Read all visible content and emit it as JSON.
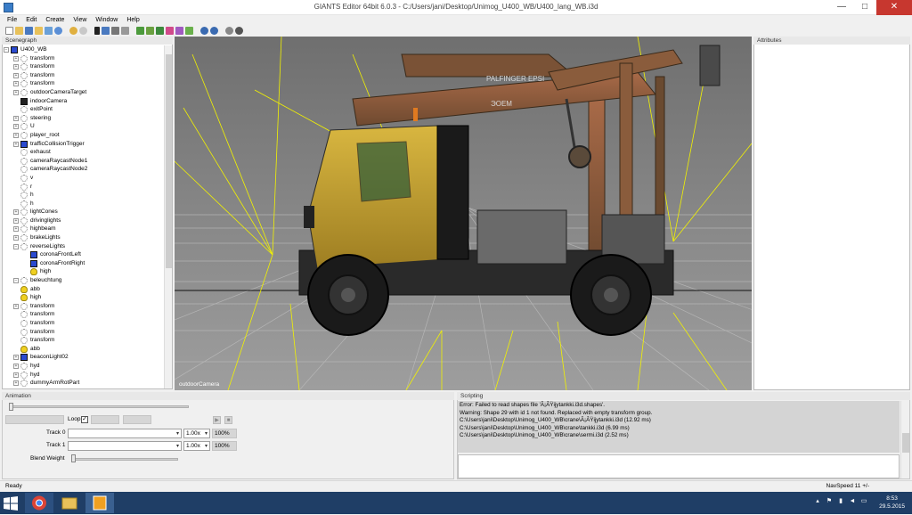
{
  "window": {
    "title": "GIANTS Editor 64bit 6.0.3 - C:/Users/jani/Desktop/Unimog_U400_WB/U400_lang_WB.i3d",
    "minimize": "—",
    "maximize": "□",
    "close": "✕"
  },
  "menu": [
    "File",
    "Edit",
    "Create",
    "View",
    "Window",
    "Help"
  ],
  "scenegraph": {
    "title": "Scenegraph",
    "items": [
      {
        "label": "U400_WB",
        "depth": 0,
        "icon": "cube-icon",
        "exp": "−"
      },
      {
        "label": "transform",
        "depth": 1,
        "icon": "transform-icon",
        "exp": "+"
      },
      {
        "label": "transform",
        "depth": 1,
        "icon": "transform-icon",
        "exp": "+"
      },
      {
        "label": "transform",
        "depth": 1,
        "icon": "transform-icon",
        "exp": "+"
      },
      {
        "label": "transform",
        "depth": 1,
        "icon": "transform-icon",
        "exp": "+"
      },
      {
        "label": "outdoorCameraTarget",
        "depth": 1,
        "icon": "transform-icon",
        "exp": "+"
      },
      {
        "label": "indoorCamera",
        "depth": 1,
        "icon": "camera-icon",
        "exp": ""
      },
      {
        "label": "exitPoint",
        "depth": 1,
        "icon": "transform-icon",
        "exp": ""
      },
      {
        "label": "steering",
        "depth": 1,
        "icon": "transform-icon",
        "exp": "+"
      },
      {
        "label": "U",
        "depth": 1,
        "icon": "transform-icon",
        "exp": "+"
      },
      {
        "label": "player_root",
        "depth": 1,
        "icon": "transform-icon",
        "exp": "+"
      },
      {
        "label": "trafficCollisionTrigger",
        "depth": 1,
        "icon": "cube-icon",
        "exp": "+"
      },
      {
        "label": "exhaust",
        "depth": 1,
        "icon": "transform-icon",
        "exp": ""
      },
      {
        "label": "cameraRaycastNode1",
        "depth": 1,
        "icon": "transform-icon",
        "exp": ""
      },
      {
        "label": "cameraRaycastNode2",
        "depth": 1,
        "icon": "transform-icon",
        "exp": ""
      },
      {
        "label": "v",
        "depth": 1,
        "icon": "transform-icon",
        "exp": ""
      },
      {
        "label": "r",
        "depth": 1,
        "icon": "transform-icon",
        "exp": ""
      },
      {
        "label": "h",
        "depth": 1,
        "icon": "transform-icon",
        "exp": ""
      },
      {
        "label": "h",
        "depth": 1,
        "icon": "transform-icon",
        "exp": ""
      },
      {
        "label": "lightCones",
        "depth": 1,
        "icon": "transform-icon",
        "exp": "+"
      },
      {
        "label": "drivinglights",
        "depth": 1,
        "icon": "transform-icon",
        "exp": "+"
      },
      {
        "label": "highbeam",
        "depth": 1,
        "icon": "transform-icon",
        "exp": "+"
      },
      {
        "label": "brakeLights",
        "depth": 1,
        "icon": "transform-icon",
        "exp": "+"
      },
      {
        "label": "reverseLights",
        "depth": 1,
        "icon": "transform-icon",
        "exp": "−"
      },
      {
        "label": "coronaFrontLeft",
        "depth": 2,
        "icon": "cube-icon",
        "exp": ""
      },
      {
        "label": "coronaFrontRight",
        "depth": 2,
        "icon": "cube-icon",
        "exp": ""
      },
      {
        "label": "high",
        "depth": 2,
        "icon": "light-icon",
        "exp": ""
      },
      {
        "label": "beleuchtung",
        "depth": 1,
        "icon": "transform-icon",
        "exp": "−"
      },
      {
        "label": "abb",
        "depth": 1,
        "icon": "light-icon",
        "exp": ""
      },
      {
        "label": "high",
        "depth": 1,
        "icon": "light-icon",
        "exp": ""
      },
      {
        "label": "transform",
        "depth": 1,
        "icon": "transform-icon",
        "exp": "+"
      },
      {
        "label": "transform",
        "depth": 1,
        "icon": "transform-icon",
        "exp": ""
      },
      {
        "label": "transform",
        "depth": 1,
        "icon": "transform-icon",
        "exp": ""
      },
      {
        "label": "transform",
        "depth": 1,
        "icon": "transform-icon",
        "exp": ""
      },
      {
        "label": "transform",
        "depth": 1,
        "icon": "transform-icon",
        "exp": ""
      },
      {
        "label": "abb",
        "depth": 1,
        "icon": "light-icon",
        "exp": ""
      },
      {
        "label": "beaconLight02",
        "depth": 1,
        "icon": "cube-icon",
        "exp": "+"
      },
      {
        "label": "hyd",
        "depth": 1,
        "icon": "transform-icon",
        "exp": "+"
      },
      {
        "label": "hyd",
        "depth": 1,
        "icon": "transform-icon",
        "exp": "+"
      },
      {
        "label": "dummyArmRotPart",
        "depth": 1,
        "icon": "transform-icon",
        "exp": "+"
      }
    ]
  },
  "viewport": {
    "camera_label": "outdoorCamera",
    "decal_text_1": "PALFINGER  EPSI",
    "decal_text_2": "ЭОЕМ"
  },
  "attributes": {
    "title": "Attributes"
  },
  "animation": {
    "title": "Animation",
    "loop_label": "Loop",
    "loop_checked": "✓",
    "play_icon": "▶",
    "stop_icon": "■",
    "tracks": [
      {
        "label": "Track 0",
        "speed": "1.00x",
        "percent": "100%"
      },
      {
        "label": "Track 1",
        "speed": "1.00x",
        "percent": "100%"
      }
    ],
    "blend_weight_label": "Blend Weight",
    "dropdown_arrow": "▾"
  },
  "scripting": {
    "title": "Scripting",
    "log": [
      "Error: Failed to read shapes file 'Ã¡ÃŸijytankki.i3d.shapes'.",
      "Warning: Shape 29 with id 1 not found. Replaced with empty transform group.",
      "C:\\Users\\jani\\Desktop\\Unimog_U400_WB\\crane\\Ã¡ÃŸijytankki.i3d (12.92 ms)",
      "C:\\Users\\jani\\Desktop\\Unimog_U400_WB\\crane\\tankki.i3d (6.99 ms)",
      "C:\\Users\\jani\\Desktop\\Unimog_U400_WB\\crane\\sermi.i3d (2.52 ms)"
    ]
  },
  "status": {
    "left": "Ready",
    "right": "NavSpeed 11 +/-"
  },
  "taskbar": {
    "time": "8:53",
    "date": "29.5.2015"
  },
  "colors": {
    "taskbar": "#1f3e66",
    "viewport_bg": "#8a8a8a",
    "close_button": "#c7372f",
    "truck_body": "#c9a52e",
    "crane": "#8c5a3a",
    "guide_lines": "#f2f200"
  }
}
